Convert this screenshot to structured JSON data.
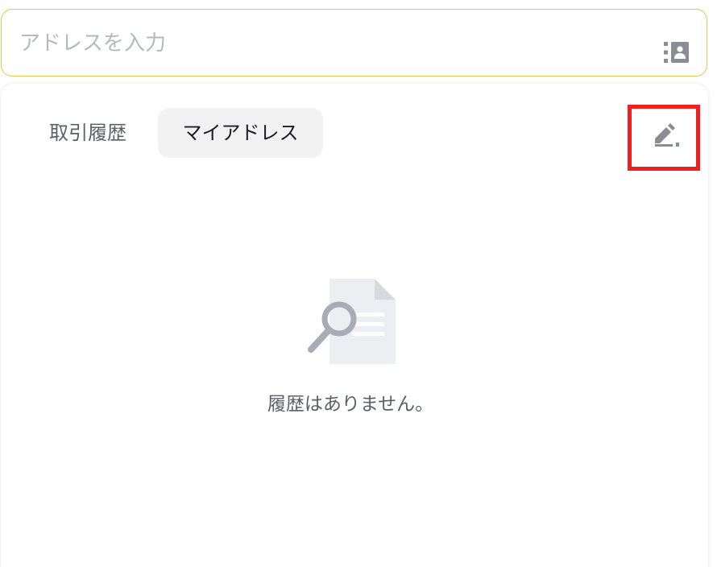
{
  "address_input": {
    "placeholder": "アドレスを入力",
    "value": ""
  },
  "icons": {
    "address_book": "address-book-icon",
    "edit": "edit-icon",
    "empty_state": "document-search-icon"
  },
  "tabs": [
    {
      "label": "取引履歴",
      "selected": false
    },
    {
      "label": "マイアドレス",
      "selected": true
    }
  ],
  "empty_state": {
    "message": "履歴はありません。"
  },
  "colors": {
    "input_border": "#e6c35a",
    "highlight": "#ee2020",
    "selected_tab_bg": "#f2f2f3",
    "icon_gray": "#8a8d96"
  }
}
